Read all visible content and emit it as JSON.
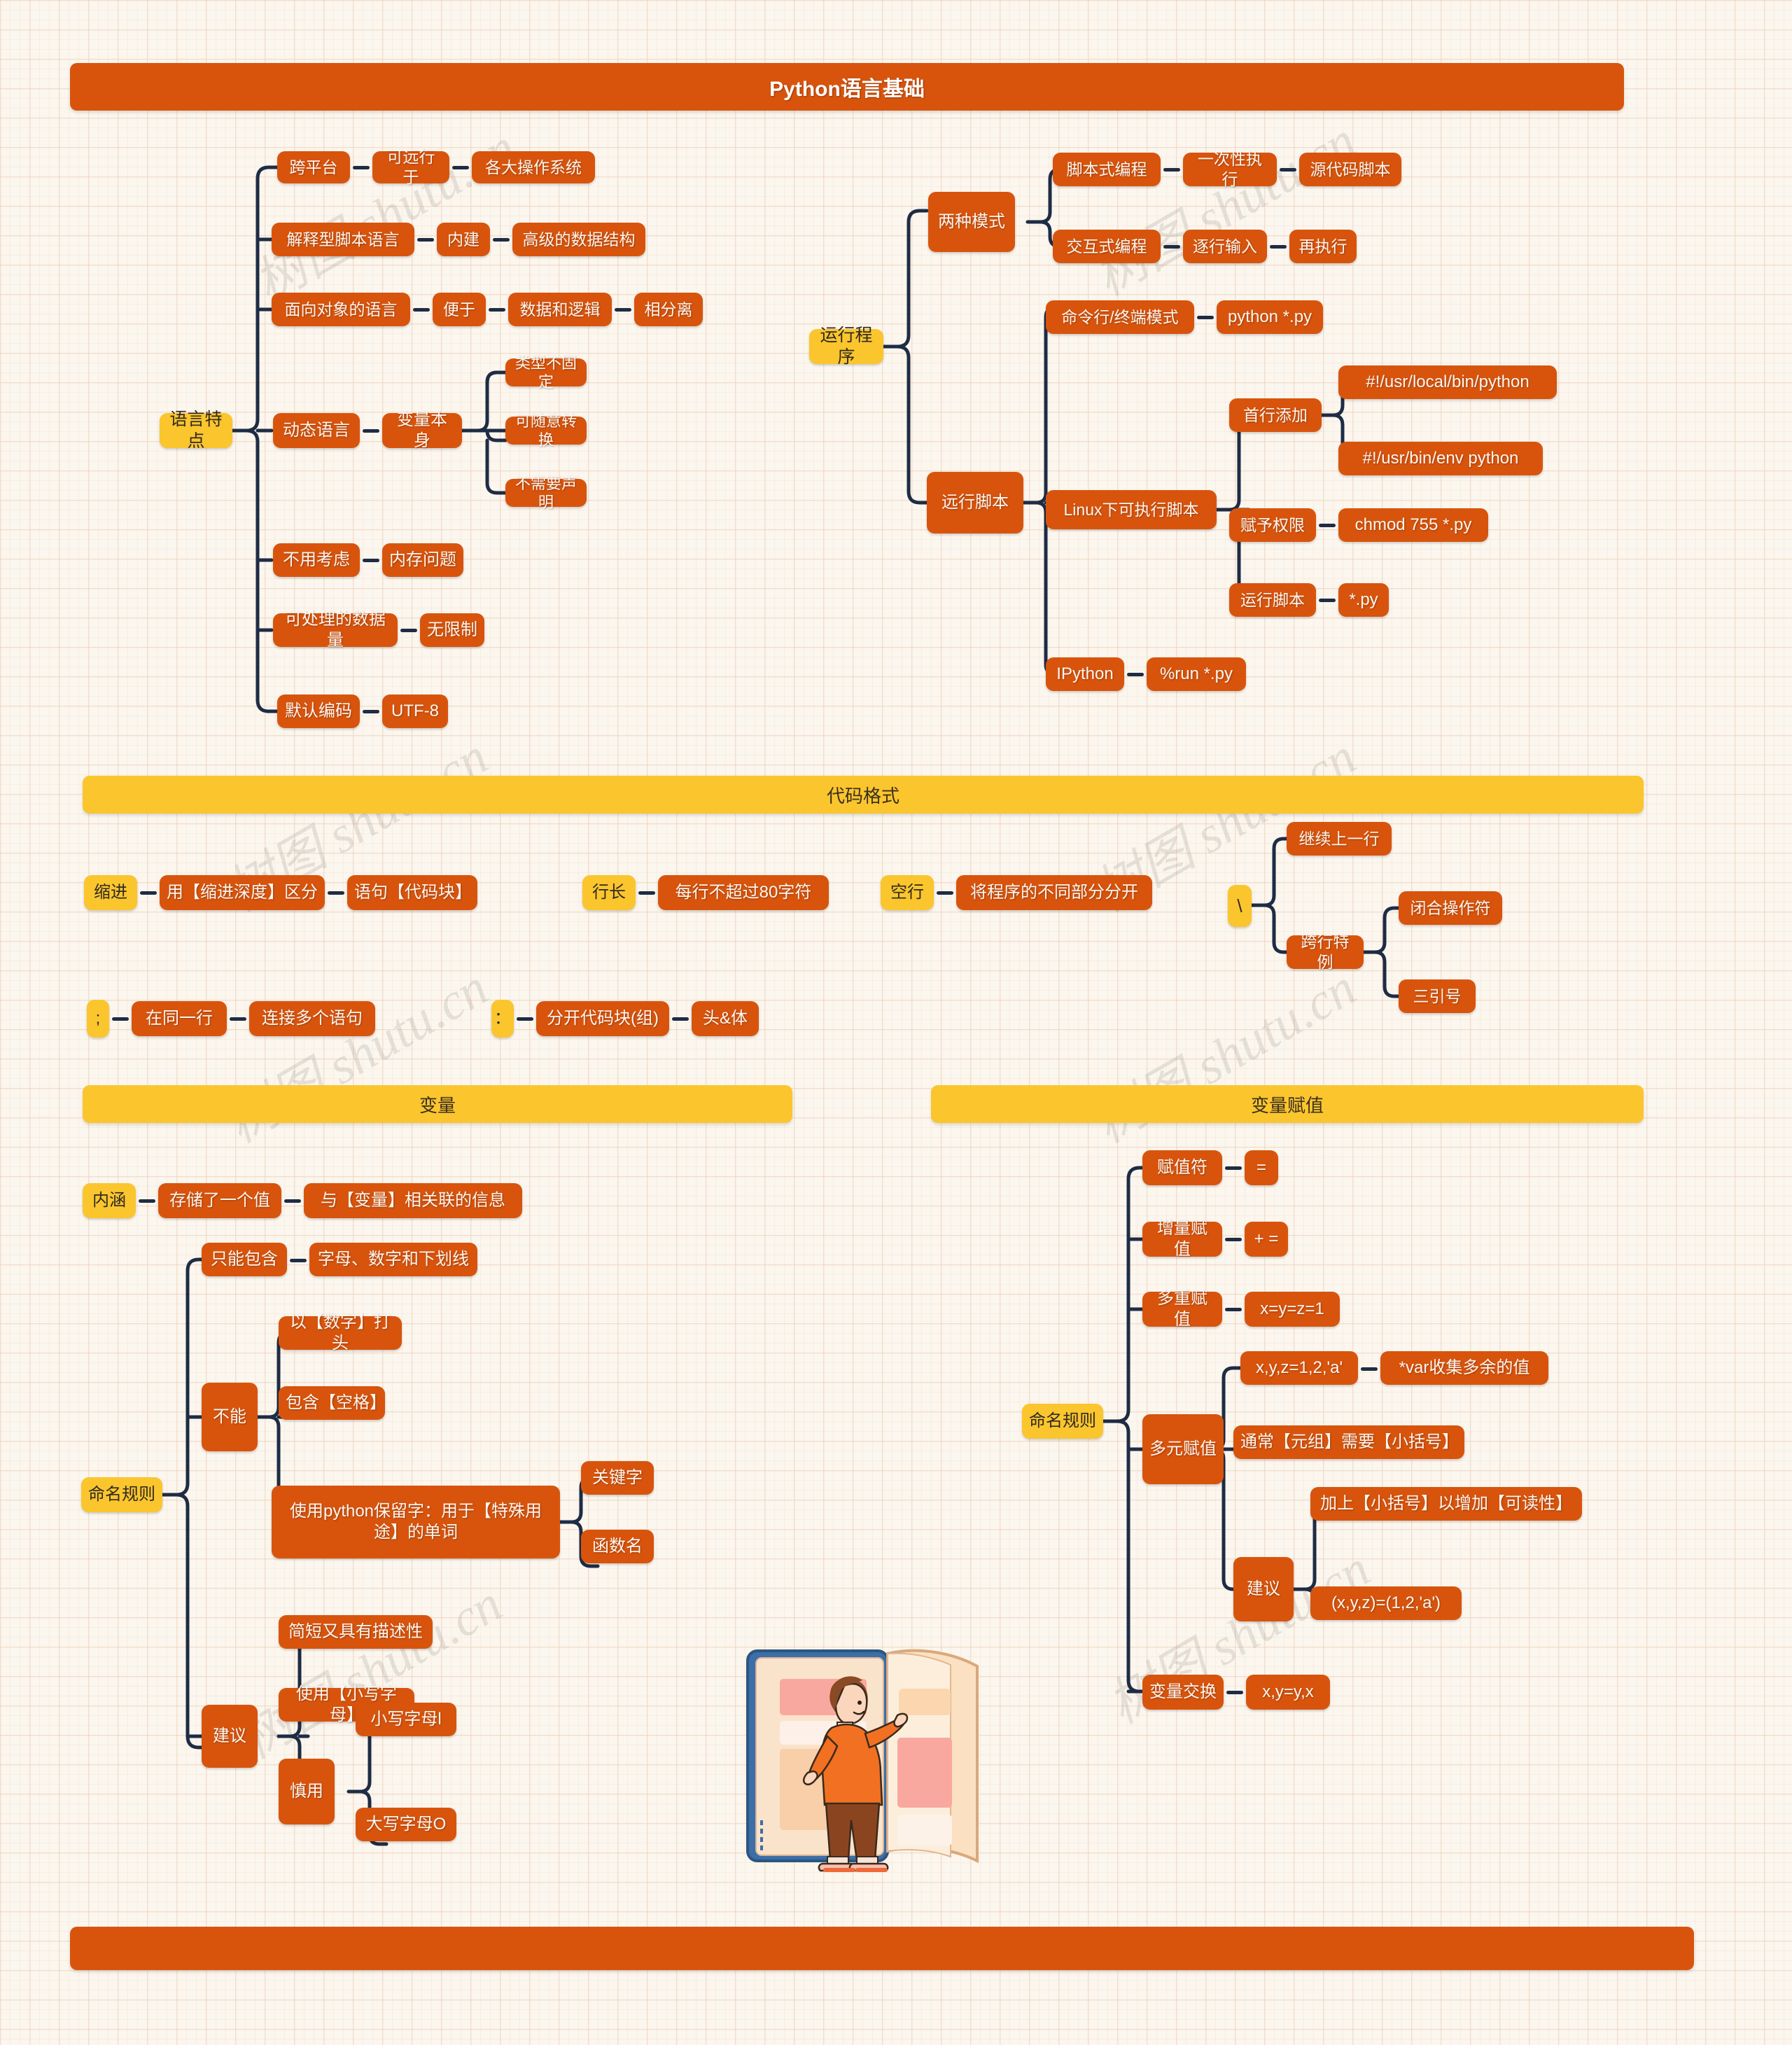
{
  "title": "Python语言基础",
  "bottom_bar": "",
  "colors": {
    "orange": "#d8540d",
    "yellow": "#fbc52d",
    "line": "#1e2c44",
    "bg": "#fbf6ee"
  },
  "watermark": "树图 shutu.cn",
  "illustration": "boy-opening-book-illustration",
  "sections": {
    "language_features": {
      "root": "语言特点",
      "items": {
        "cross_platform": "跨平台",
        "cross_platform_1": "可远行于",
        "cross_platform_2": "各大操作系统",
        "interpreted": "解释型脚本语言",
        "interpreted_1": "内建",
        "interpreted_2": "高级的数据结构",
        "oop": "面向对象的语言",
        "oop_1": "便于",
        "oop_2": "数据和逻辑",
        "oop_3": "相分离",
        "dynamic": "动态语言",
        "dynamic_1": "变量本身",
        "dynamic_1_a": "类型不固定",
        "dynamic_1_b": "可随意转换",
        "dynamic_1_c": "不需要声明",
        "memory": "不用考虑",
        "memory_1": "内存问题",
        "datasize": "可处理的数据量",
        "datasize_1": "无限制",
        "encoding": "默认编码",
        "encoding_1": "UTF-8"
      }
    },
    "run_program": {
      "root": "运行程序",
      "items": {
        "two_modes": "两种模式",
        "script_mode": "脚本式编程",
        "script_mode_1": "一次性执行",
        "script_mode_2": "源代码脚本",
        "interactive_mode": "交互式编程",
        "interactive_mode_1": "逐行输入",
        "interactive_mode_2": "再执行",
        "run_script": "远行脚本",
        "cli": "命令行/终端模式",
        "cli_1": "python *.py",
        "linux": "Linux下可执行脚本",
        "first_line": "首行添加",
        "first_line_a": "#!/usr/local/bin/python",
        "first_line_b": "#!/usr/bin/env python",
        "permission": "赋予权限",
        "permission_1": "chmod 755 *.py",
        "run_sh": "运行脚本",
        "run_sh_1": "*.py",
        "ipython": "IPython",
        "ipython_1": "%run *.py"
      }
    },
    "code_format": {
      "header": "代码格式",
      "items": {
        "indent": "缩进",
        "indent_1": "用【缩进深度】区分",
        "indent_2": "语句【代码块】",
        "line_len": "行长",
        "line_len_1": "每行不超过80字符",
        "blank_line": "空行",
        "blank_line_1": "将程序的不同部分分开",
        "backslash": "\\",
        "backslash_1": "继续上一行",
        "backslash_2": "跨行特例",
        "backslash_2a": "闭合操作符",
        "backslash_2b": "三引号",
        "semicolon": ";",
        "semicolon_1": "在同一行",
        "semicolon_2": "连接多个语句",
        "colon": "：",
        "colon_1": "分开代码块(组)",
        "colon_2": "头&体"
      }
    },
    "variable": {
      "header": "变量",
      "items": {
        "meaning": "内涵",
        "meaning_1": "存储了一个值",
        "meaning_2": "与【变量】相关联的信息",
        "naming": "命名规则",
        "only_contain": "只能包含",
        "only_contain_1": "字母、数字和下划线",
        "cannot": "不能",
        "cannot_a": "以【数字】打头",
        "cannot_b": "包含【空格】",
        "cannot_c": "使用python保留字：用于【特殊用途】的单词",
        "cannot_c1": "关键字",
        "cannot_c2": "函数名",
        "suggest": "建议",
        "suggest_a": "简短又具有描述性",
        "suggest_b": "使用【小写字母】",
        "suggest_c": "慎用",
        "suggest_c1": "小写字母l",
        "suggest_c2": "大写字母O"
      }
    },
    "assignment": {
      "header": "变量赋值",
      "items": {
        "naming": "命名规则",
        "assign_op": "赋值符",
        "assign_op_1": "=",
        "aug_assign": "增量赋值",
        "aug_assign_1": "+ =",
        "multi_assign": "多重赋值",
        "multi_assign_1": "x=y=z=1",
        "multivar": "多元赋值",
        "multivar_a": "x,y,z=1,2,'a'",
        "multivar_a1": "*var收集多余的值",
        "multivar_b": "通常【元组】需要【小括号】",
        "multivar_c": "建议",
        "multivar_c1": "加上【小括号】以增加【可读性】",
        "multivar_c2": "(x,y,z)=(1,2,'a')",
        "swap": "变量交换",
        "swap_1": "x,y=y,x"
      }
    }
  }
}
